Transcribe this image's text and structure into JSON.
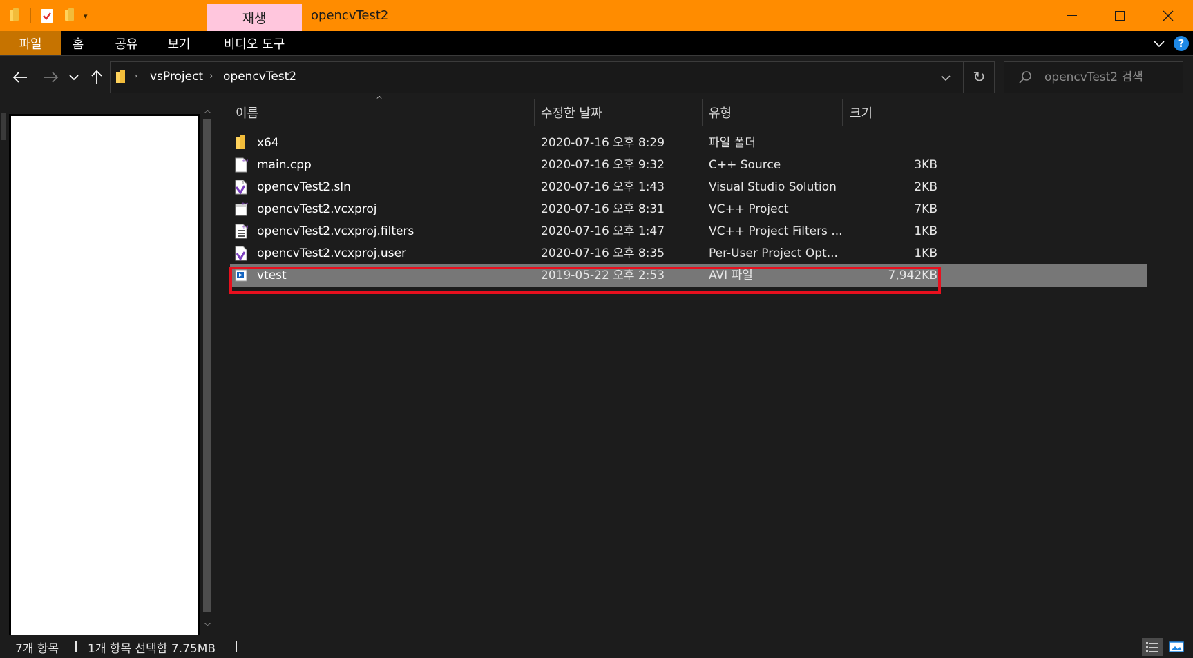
{
  "titlebar": {
    "context_tab": "재생",
    "window_title": "opencvTest2"
  },
  "ribbon": {
    "tabs": [
      {
        "label": "파일"
      },
      {
        "label": "홈"
      },
      {
        "label": "공유"
      },
      {
        "label": "보기"
      },
      {
        "label": "비디오 도구"
      }
    ],
    "help_label": "?"
  },
  "address": {
    "breadcrumbs": [
      "vsProject",
      "opencvTest2"
    ]
  },
  "search": {
    "placeholder": "opencvTest2 검색"
  },
  "columns": {
    "name": "이름",
    "date": "수정한 날짜",
    "type": "유형",
    "size": "크기"
  },
  "files": [
    {
      "name": "x64",
      "date": "2020-07-16 오후 8:29",
      "type": "파일 폴더",
      "size": "",
      "icon": "folder-icon"
    },
    {
      "name": "main.cpp",
      "date": "2020-07-16 오후 9:32",
      "type": "C++ Source",
      "size": "3KB",
      "icon": "cpp-file-icon"
    },
    {
      "name": "opencvTest2.sln",
      "date": "2020-07-16 오후 1:43",
      "type": "Visual Studio Solution",
      "size": "2KB",
      "icon": "vs-solution-icon"
    },
    {
      "name": "opencvTest2.vcxproj",
      "date": "2020-07-16 오후 8:31",
      "type": "VC++ Project",
      "size": "7KB",
      "icon": "vcxproj-file-icon"
    },
    {
      "name": "opencvTest2.vcxproj.filters",
      "date": "2020-07-16 오후 1:47",
      "type": "VC++ Project Filters ...",
      "size": "1KB",
      "icon": "filters-file-icon"
    },
    {
      "name": "opencvTest2.vcxproj.user",
      "date": "2020-07-16 오후 8:35",
      "type": "Per-User Project Opt...",
      "size": "1KB",
      "icon": "user-file-icon"
    },
    {
      "name": "vtest",
      "date": "2019-05-22 오후 2:53",
      "type": "AVI 파일",
      "size": "7,942KB",
      "icon": "video-file-icon",
      "selected": true
    }
  ],
  "status": {
    "item_count": "7개 항목",
    "selection": "1개 항목 선택함 7.75MB"
  },
  "colors": {
    "titlebar": "#ff8c00",
    "file_tab": "#c67300",
    "context_tab": "#ffc6dd",
    "selected_row": "#777777",
    "highlight_box": "#e8101e"
  }
}
